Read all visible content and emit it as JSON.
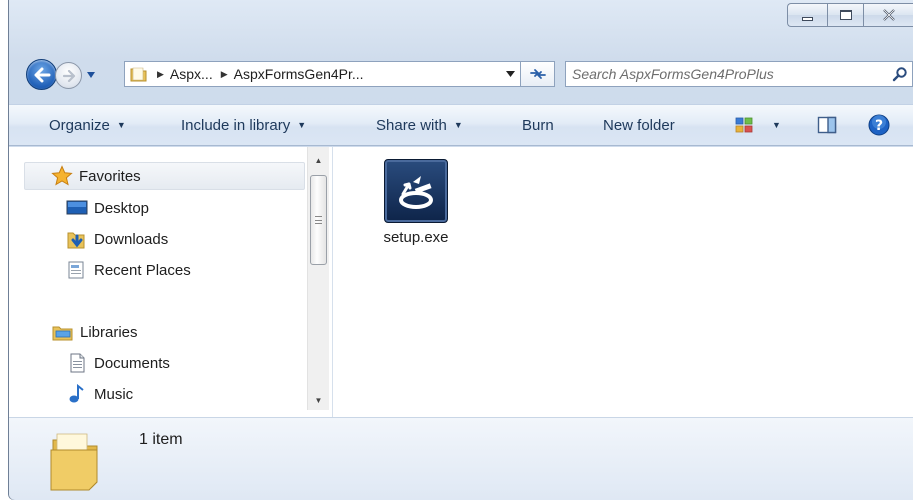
{
  "window": {
    "caption_buttons": [
      "minimize",
      "maximize",
      "close"
    ]
  },
  "address": {
    "crumbs": [
      "Aspx...",
      "AspxFormsGen4Pr..."
    ]
  },
  "search": {
    "placeholder": "Search AspxFormsGen4ProPlus"
  },
  "toolbar": {
    "organize": "Organize",
    "include_in_library": "Include in library",
    "share_with": "Share with",
    "burn": "Burn",
    "new_folder": "New folder"
  },
  "nav": {
    "favorites": "Favorites",
    "desktop": "Desktop",
    "downloads": "Downloads",
    "recent_places": "Recent Places",
    "libraries": "Libraries",
    "documents": "Documents",
    "music": "Music"
  },
  "files": [
    {
      "name": "setup.exe",
      "icon": "installer-icon"
    }
  ],
  "details": {
    "count": "1 item"
  },
  "colors": {
    "toolbar_text": "#1e395b",
    "frame": "#cfdcec",
    "back_button": "#1f5fb7"
  }
}
